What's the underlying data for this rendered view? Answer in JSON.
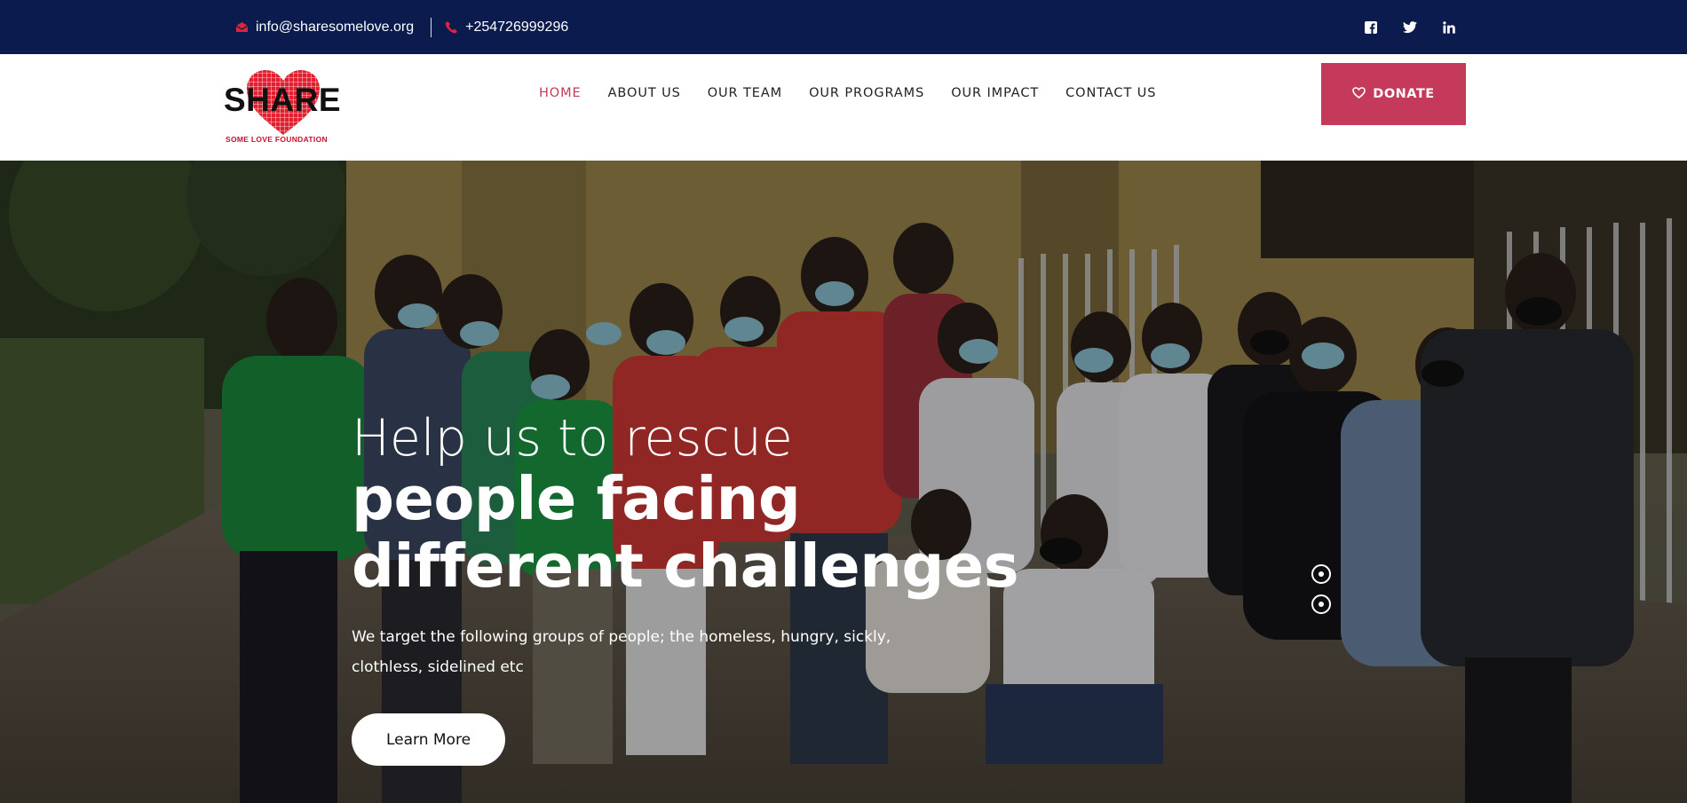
{
  "topbar": {
    "email": "info@sharesomelove.org",
    "phone": "+254726999296",
    "email_icon": "envelope-icon",
    "phone_icon": "phone-icon",
    "social": [
      {
        "name": "facebook-icon",
        "glyph": "f"
      },
      {
        "name": "twitter-icon",
        "glyph": "t"
      },
      {
        "name": "linkedin-icon",
        "glyph": "in"
      }
    ],
    "bg_color": "#0b1b4d",
    "icon_color": "#e0233d"
  },
  "logo": {
    "wordmark": "SHARE",
    "tagline": "SOME LOVE FOUNDATION"
  },
  "nav": {
    "items": [
      {
        "label": "HOME",
        "active": true
      },
      {
        "label": "ABOUT US"
      },
      {
        "label": "OUR TEAM"
      },
      {
        "label": "OUR PROGRAMS"
      },
      {
        "label": "OUR IMPACT"
      },
      {
        "label": "CONTACT US"
      }
    ],
    "accent_color": "#c53a5b"
  },
  "donate": {
    "label": "DONATE",
    "icon": "heart-outline-icon"
  },
  "hero": {
    "title_light": "Help us to rescue",
    "title_bold_1": "people facing",
    "title_bold_2": "different challenges",
    "description": "We target the following groups of people; the homeless, hungry, sickly, clothless, sidelined etc",
    "cta_label": "Learn More",
    "slides": 2,
    "active_slide": 1
  }
}
